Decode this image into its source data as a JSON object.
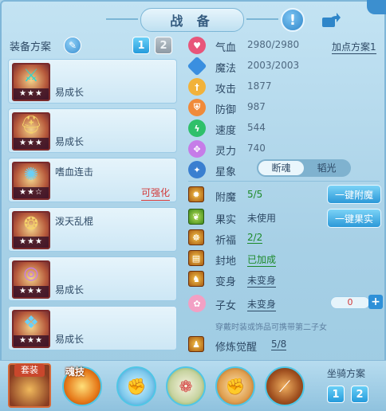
{
  "header": {
    "title": "战 备"
  },
  "left": {
    "scheme_label": "装备方案",
    "scheme_buttons": [
      "1",
      "2"
    ],
    "equipment": [
      {
        "name": "易成长",
        "stars": "★★★",
        "tag": ""
      },
      {
        "name": "易成长",
        "stars": "★★★",
        "tag": ""
      },
      {
        "name": "嗜血连击",
        "stars": "★★☆",
        "tag": "可强化"
      },
      {
        "name": "泼天乱棍",
        "stars": "★★★",
        "tag": ""
      },
      {
        "name": "易成长",
        "stars": "★★★",
        "tag": ""
      },
      {
        "name": "易成长",
        "stars": "★★★",
        "tag": ""
      }
    ]
  },
  "stats": {
    "plan_label": "加点方案1",
    "rows": [
      {
        "label": "气血",
        "value": "2980/2980",
        "color": "#e8557a"
      },
      {
        "label": "魔法",
        "value": "2003/2003",
        "color": "#3a8fe0"
      },
      {
        "label": "攻击",
        "value": "1877",
        "color": "#f2b23a"
      },
      {
        "label": "防御",
        "value": "987",
        "color": "#f08a3a"
      },
      {
        "label": "速度",
        "value": "544",
        "color": "#2fc06a"
      },
      {
        "label": "灵力",
        "value": "740",
        "color": "#c67ce8"
      }
    ],
    "star_label": "星象",
    "star_options": [
      "断魂",
      "韬光"
    ]
  },
  "enhance": {
    "rows": [
      {
        "label": "附魔",
        "value": "5/5"
      },
      {
        "label": "果实",
        "value": "未使用"
      },
      {
        "label": "祈福",
        "value": "2/2"
      },
      {
        "label": "封地",
        "value": "已加成"
      },
      {
        "label": "变身",
        "value": "未变身"
      },
      {
        "label": "子女",
        "value": "未变身"
      },
      {
        "label": "修炼觉醒",
        "value": "5/8"
      }
    ],
    "btn_enchant": "一键附魔",
    "btn_fruit": "一键果实",
    "child_count": "0",
    "hint": "穿戴时装或饰品可携带第二子女"
  },
  "bottom": {
    "suit_label": "套装",
    "soul_label": "魂技",
    "mount_label": "坐骑方案",
    "mount_buttons": [
      "1",
      "2"
    ]
  }
}
